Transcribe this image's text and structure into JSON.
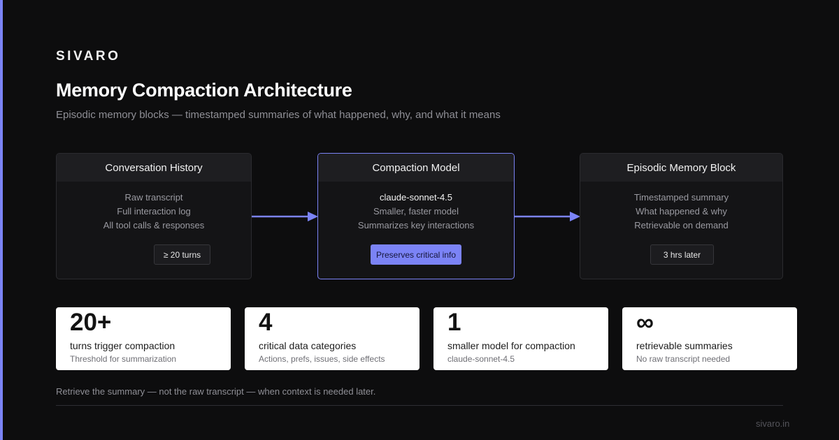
{
  "brand": "SIVARO",
  "title": "Memory Compaction Architecture",
  "subtitle": "Episodic memory blocks — timestamped summaries of what happened, why, and what it means",
  "boxes": [
    {
      "heading": "Conversation History",
      "lines": [
        "Raw transcript",
        "Full interaction log",
        "All tool calls & responses"
      ],
      "pill": "≥ 20 turns"
    },
    {
      "heading": "Compaction Model",
      "lines": [
        "claude-sonnet-4.5",
        "Smaller, faster model",
        "Summarizes key interactions"
      ],
      "pill": "Preserves critical info"
    },
    {
      "heading": "Episodic Memory Block",
      "lines": [
        "Timestamped summary",
        "What happened & why",
        "Retrievable on demand"
      ],
      "pill": "3 hrs later"
    }
  ],
  "stats": [
    {
      "value": "20+",
      "label": "turns trigger compaction",
      "sub": "Threshold for summarization"
    },
    {
      "value": "4",
      "label": "critical data categories",
      "sub": "Actions, prefs, issues, side effects"
    },
    {
      "value": "1",
      "label": "smaller model for compaction",
      "sub": "claude-sonnet-4.5"
    },
    {
      "value": "∞",
      "label": "retrievable summaries",
      "sub": "No raw transcript needed"
    }
  ],
  "footnote": "Retrieve the summary — not the raw transcript — when context is needed later.",
  "footer_url": "sivaro.in",
  "colors": {
    "accent": "#7b83f6",
    "background": "#0d0d0e",
    "card": "#ffffff"
  }
}
